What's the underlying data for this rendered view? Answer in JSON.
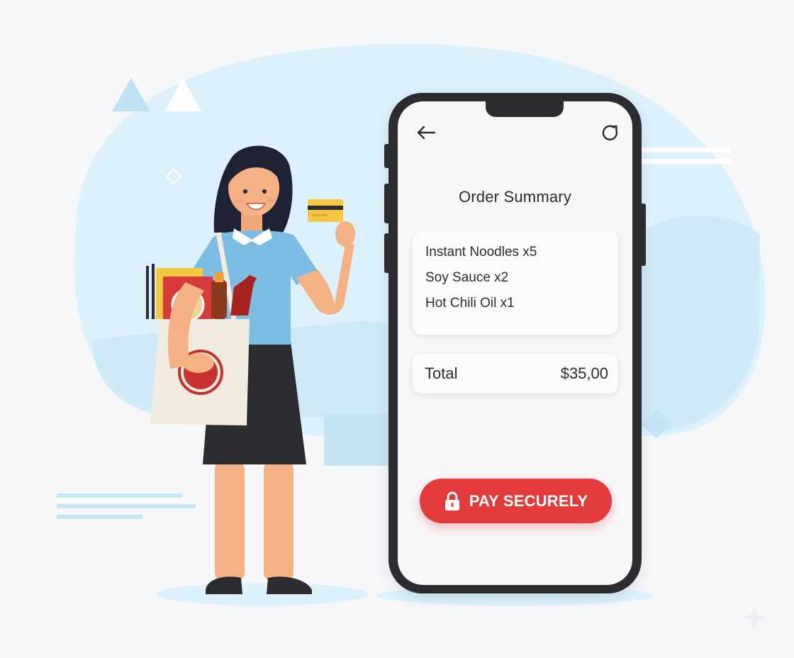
{
  "order_summary": {
    "title": "Order Summary",
    "items": [
      {
        "label": "Instant Noodles x5"
      },
      {
        "label": "Soy Sauce x2"
      },
      {
        "label": "Hot Chili Oil x1"
      }
    ],
    "total_label": "Total",
    "total_value": "$35,00",
    "pay_button_label": "PAY SECURELY"
  },
  "toolbar": {
    "back_icon": "arrow-left-icon",
    "refresh_icon": "refresh-icon"
  },
  "colors": {
    "accent": "#e33b3b",
    "phone_frame": "#2a2c30",
    "screen_bg": "#f7f7f8",
    "backdrop_blue": "#dcf1fb",
    "shirt": "#7dbde3"
  }
}
